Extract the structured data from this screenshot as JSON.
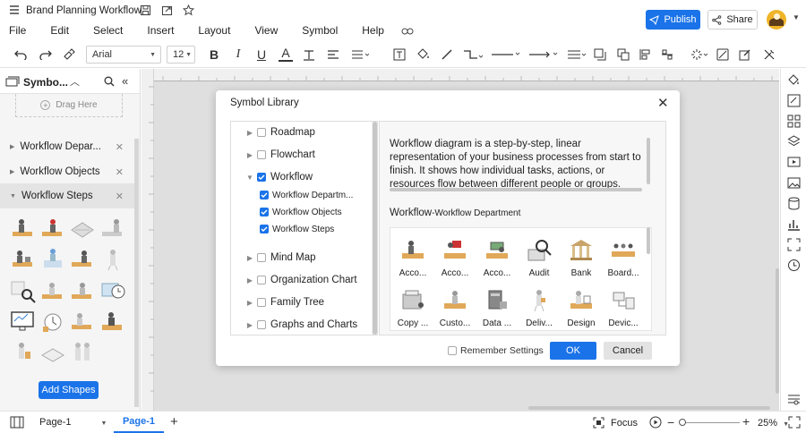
{
  "app": {
    "title": "Brand Planning Workflow",
    "publish_label": "Publish",
    "share_label": "Share"
  },
  "menu": [
    "File",
    "Edit",
    "Select",
    "Insert",
    "Layout",
    "View",
    "Symbol",
    "Help"
  ],
  "toolbar": {
    "font_family": "Arial",
    "font_size": "12"
  },
  "left_panel": {
    "title": "Symbo...",
    "drag_here": "Drag Here",
    "libraries": [
      {
        "label": "Workflow Depar..."
      },
      {
        "label": "Workflow Objects"
      },
      {
        "label": "Workflow Steps"
      }
    ],
    "add_shapes_label": "Add Shapes"
  },
  "dialog": {
    "title": "Symbol Library",
    "tree": [
      {
        "label": "Roadmap",
        "checked": false
      },
      {
        "label": "Flowchart",
        "checked": false
      },
      {
        "label": "Workflow",
        "checked": true
      },
      {
        "label": "Workflow Departm...",
        "checked": true
      },
      {
        "label": "Workflow Objects",
        "checked": true
      },
      {
        "label": "Workflow Steps",
        "checked": true
      },
      {
        "label": "Mind Map",
        "checked": false
      },
      {
        "label": "Organization Chart",
        "checked": false
      },
      {
        "label": "Family Tree",
        "checked": false
      },
      {
        "label": "Graphs and Charts",
        "checked": false
      }
    ],
    "description": "Workflow diagram is a step-by-step, linear representation of your business processes from start to finish. It shows how individual tasks, actions, or resources flow between different people or groups.",
    "section_main": "Workflow",
    "section_sub": "-Workflow Department",
    "symbols_row1": [
      "Acco...",
      "Acco...",
      "Acco...",
      "Audit",
      "Bank",
      "Board..."
    ],
    "symbols_row2": [
      "Copy ...",
      "Custo...",
      "Data ...",
      "Deliv...",
      "Design",
      "Devic..."
    ],
    "remember_label": "Remember Settings",
    "ok_label": "OK",
    "cancel_label": "Cancel"
  },
  "status": {
    "page_selector": "Page-1",
    "page_tab": "Page-1",
    "focus_label": "Focus",
    "zoom": "25%"
  },
  "colors": {
    "accent": "#1a73e8",
    "panel_bg": "#f5f5f5",
    "canvas_bg": "#e9e9e9"
  }
}
